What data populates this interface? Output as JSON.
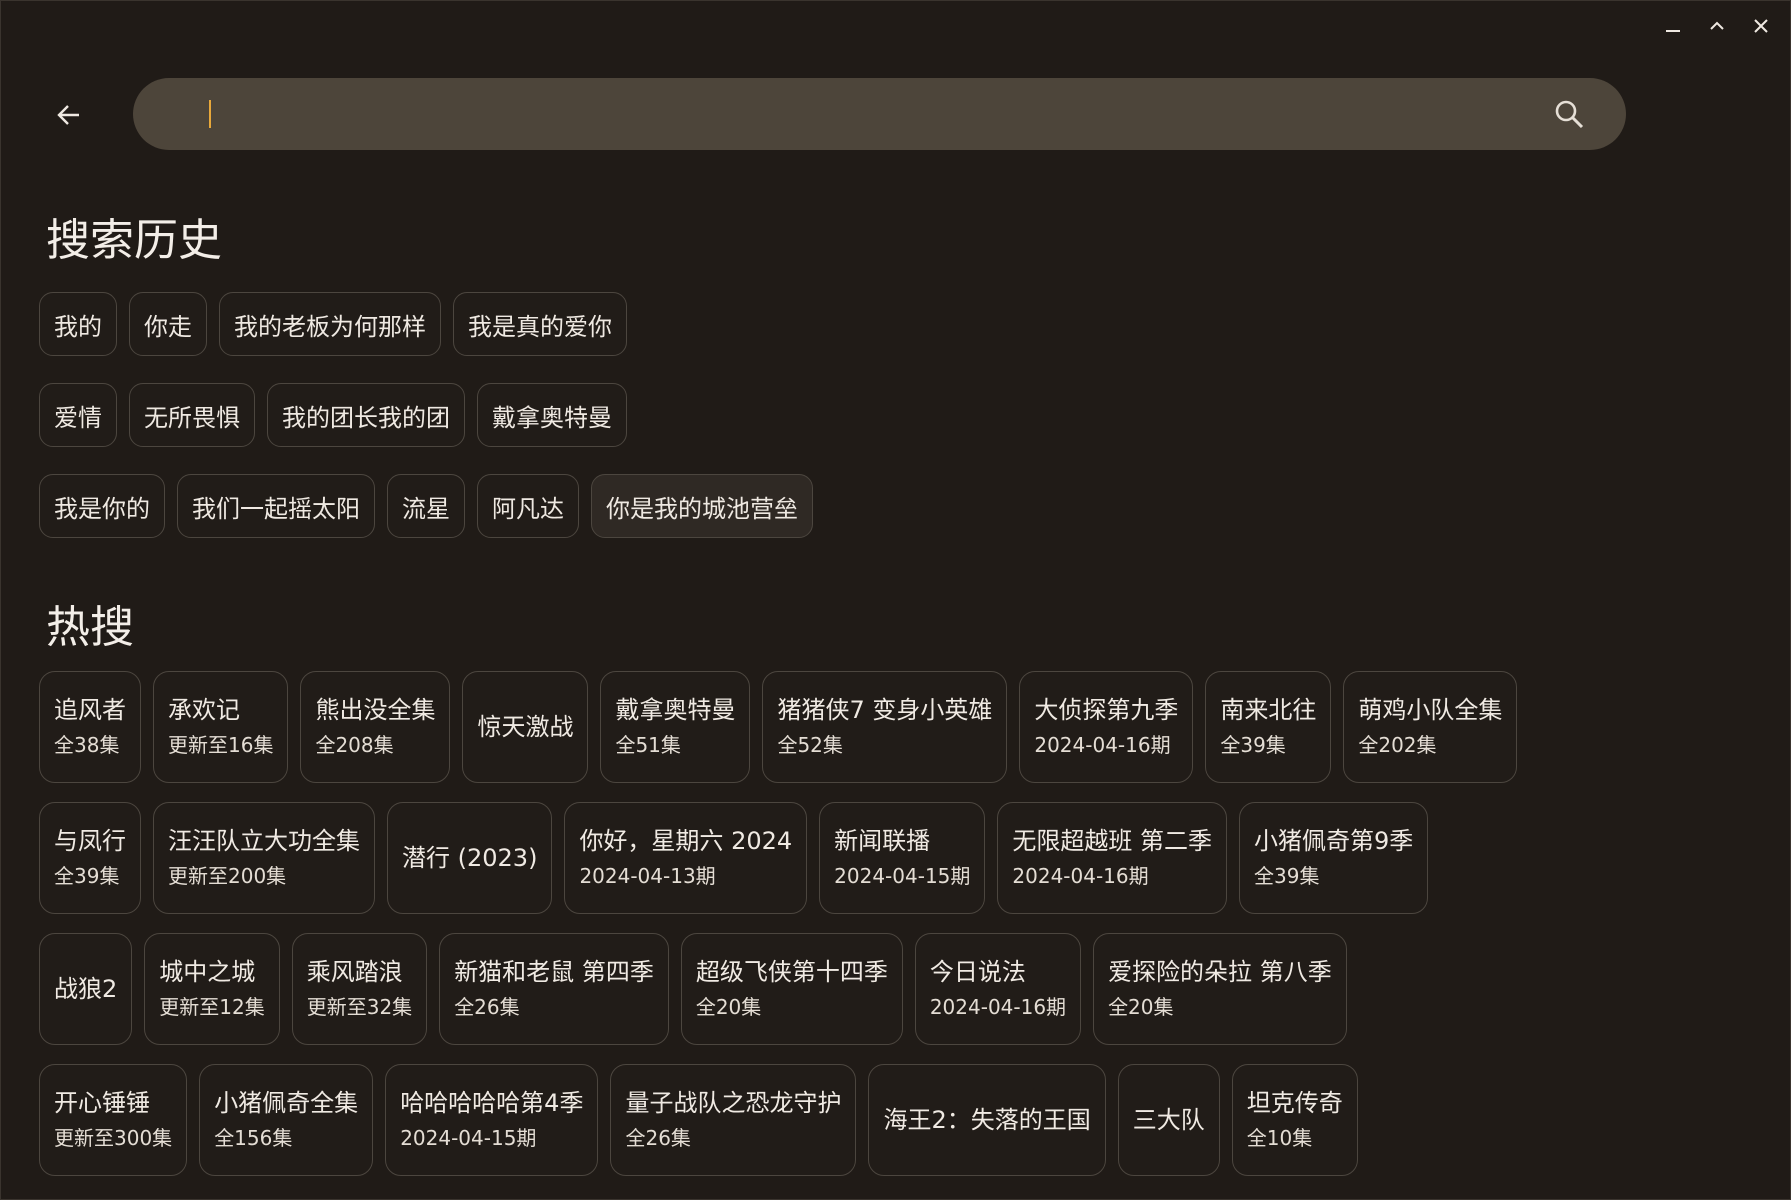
{
  "search": {
    "value": "",
    "placeholder": ""
  },
  "history": {
    "title": "搜索历史",
    "rows": [
      [
        "我的",
        "你走",
        "我的老板为何那样",
        "我是真的爱你"
      ],
      [
        "爱情",
        "无所畏惧",
        "我的团长我的团",
        "戴拿奥特曼"
      ],
      [
        "我是你的",
        "我们一起摇太阳",
        "流星",
        "阿凡达",
        "你是我的城池营垒"
      ]
    ]
  },
  "hot": {
    "title": "热搜",
    "rows": [
      [
        {
          "title": "追风者",
          "sub": "全38集"
        },
        {
          "title": "承欢记",
          "sub": "更新至16集"
        },
        {
          "title": "熊出没全集",
          "sub": "全208集"
        },
        {
          "title": "惊天激战",
          "sub": ""
        },
        {
          "title": "戴拿奥特曼",
          "sub": "全51集"
        },
        {
          "title": "猪猪侠7 变身小英雄",
          "sub": "全52集"
        },
        {
          "title": "大侦探第九季",
          "sub": "2024-04-16期"
        },
        {
          "title": "南来北往",
          "sub": "全39集"
        },
        {
          "title": "萌鸡小队全集",
          "sub": "全202集"
        }
      ],
      [
        {
          "title": "与凤行",
          "sub": "全39集"
        },
        {
          "title": "汪汪队立大功全集",
          "sub": "更新至200集"
        },
        {
          "title": "潜行 (2023)",
          "sub": ""
        },
        {
          "title": "你好，星期六 2024",
          "sub": "2024-04-13期"
        },
        {
          "title": "新闻联播",
          "sub": "2024-04-15期"
        },
        {
          "title": "无限超越班 第二季",
          "sub": "2024-04-16期"
        },
        {
          "title": "小猪佩奇第9季",
          "sub": "全39集"
        }
      ],
      [
        {
          "title": "战狼2",
          "sub": ""
        },
        {
          "title": "城中之城",
          "sub": "更新至12集"
        },
        {
          "title": "乘风踏浪",
          "sub": "更新至32集"
        },
        {
          "title": "新猫和老鼠 第四季",
          "sub": "全26集"
        },
        {
          "title": "超级飞侠第十四季",
          "sub": "全20集"
        },
        {
          "title": "今日说法",
          "sub": "2024-04-16期"
        },
        {
          "title": "爱探险的朵拉 第八季",
          "sub": "全20集"
        }
      ],
      [
        {
          "title": "开心锤锤",
          "sub": "更新至300集"
        },
        {
          "title": "小猪佩奇全集",
          "sub": "全156集"
        },
        {
          "title": "哈哈哈哈哈第4季",
          "sub": "2024-04-15期"
        },
        {
          "title": "量子战队之恐龙守护",
          "sub": "全26集"
        },
        {
          "title": "海王2：失落的王国",
          "sub": ""
        },
        {
          "title": "三大队",
          "sub": ""
        },
        {
          "title": "坦克传奇",
          "sub": "全10集"
        }
      ]
    ]
  },
  "icons": {
    "minimize": "minimize-icon",
    "maximize": "chevron-up-icon",
    "close": "close-icon",
    "back": "arrow-left-icon",
    "search": "search-icon"
  },
  "colors": {
    "background": "#201b17",
    "search_bar": "#4d453a",
    "caret": "#e8a83a"
  }
}
